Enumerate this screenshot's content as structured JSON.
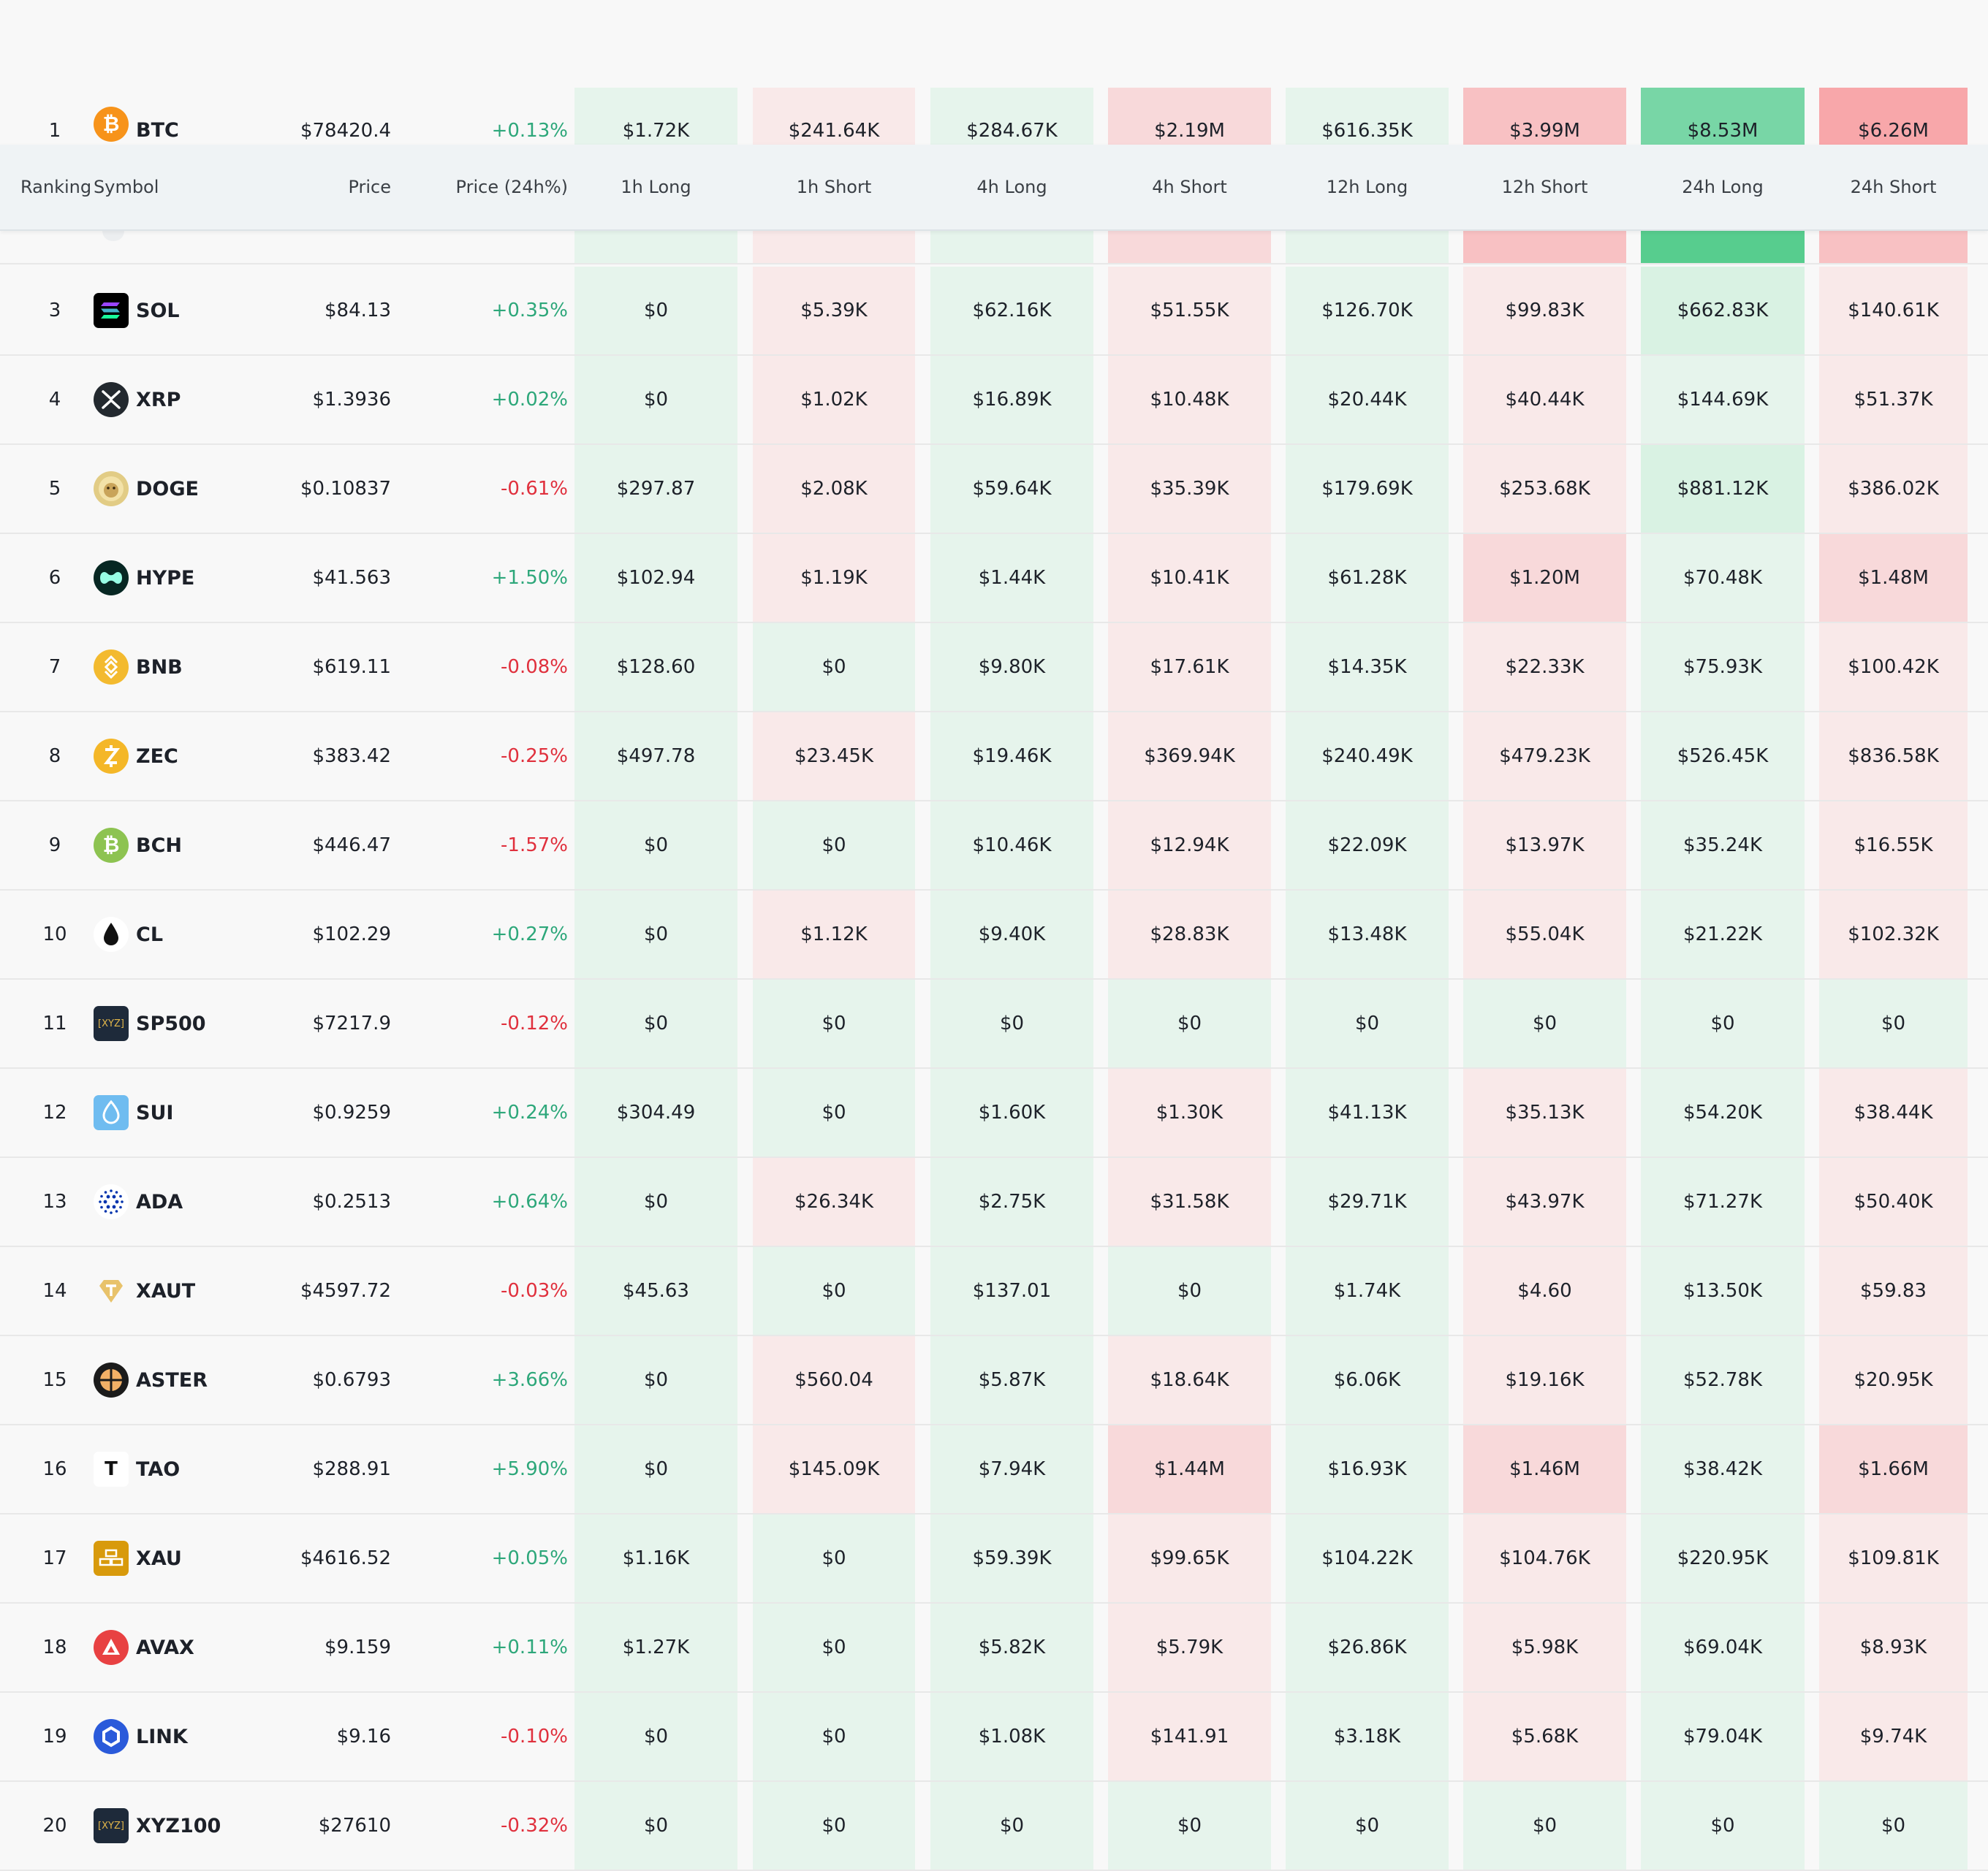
{
  "colors": {
    "long_light": "#e6f4ec",
    "long_mid": "#d9f2e3",
    "long_strong": "#78d6a6",
    "long_stronger": "#57cd8e",
    "short_light": "#f9e9e9",
    "short_mid": "#f8d9da",
    "short_strong": "#f8c1c3",
    "short_stronger": "#f8a7aa",
    "positive_text": "#2da77a",
    "negative_text": "#e0303d",
    "header_bg": "#eff3f5"
  },
  "header": {
    "ranking": "Ranking",
    "symbol": "Symbol",
    "price": "Price",
    "price_24h": "Price (24h%)",
    "h1_long": "1h Long",
    "h1_short": "1h Short",
    "h4_long": "4h Long",
    "h4_short": "4h Short",
    "h12_long": "12h Long",
    "h12_short": "12h Short",
    "h24_long": "24h Long",
    "h24_short": "24h Short"
  },
  "rows": [
    {
      "rank": "1",
      "symbol": "BTC",
      "icon": "bitcoin-icon",
      "price": "$78420.4",
      "change": "+0.13%",
      "dir": "pos",
      "liq": [
        "$1.72K",
        "$241.64K",
        "$284.67K",
        "$2.19M",
        "$616.35K",
        "$3.99M",
        "$8.53M",
        "$6.26M"
      ],
      "bg": [
        "long_light",
        "short_light",
        "long_light",
        "short_mid",
        "long_light",
        "short_strong",
        "long_strong",
        "short_stronger"
      ]
    },
    {
      "rank": "3",
      "symbol": "SOL",
      "icon": "solana-icon",
      "price": "$84.13",
      "change": "+0.35%",
      "dir": "pos",
      "liq": [
        "$0",
        "$5.39K",
        "$62.16K",
        "$51.55K",
        "$126.70K",
        "$99.83K",
        "$662.83K",
        "$140.61K"
      ],
      "bg": [
        "long_light",
        "short_light",
        "long_light",
        "short_light",
        "long_light",
        "short_light",
        "long_mid",
        "short_light"
      ]
    },
    {
      "rank": "4",
      "symbol": "XRP",
      "icon": "xrp-icon",
      "price": "$1.3936",
      "change": "+0.02%",
      "dir": "pos",
      "liq": [
        "$0",
        "$1.02K",
        "$16.89K",
        "$10.48K",
        "$20.44K",
        "$40.44K",
        "$144.69K",
        "$51.37K"
      ],
      "bg": [
        "long_light",
        "short_light",
        "long_light",
        "short_light",
        "long_light",
        "short_light",
        "long_light",
        "short_light"
      ]
    },
    {
      "rank": "5",
      "symbol": "DOGE",
      "icon": "doge-icon",
      "price": "$0.10837",
      "change": "-0.61%",
      "dir": "neg",
      "liq": [
        "$297.87",
        "$2.08K",
        "$59.64K",
        "$35.39K",
        "$179.69K",
        "$253.68K",
        "$881.12K",
        "$386.02K"
      ],
      "bg": [
        "long_light",
        "short_light",
        "long_light",
        "short_light",
        "long_light",
        "short_light",
        "long_mid",
        "short_light"
      ]
    },
    {
      "rank": "6",
      "symbol": "HYPE",
      "icon": "hype-icon",
      "price": "$41.563",
      "change": "+1.50%",
      "dir": "pos",
      "liq": [
        "$102.94",
        "$1.19K",
        "$1.44K",
        "$10.41K",
        "$61.28K",
        "$1.20M",
        "$70.48K",
        "$1.48M"
      ],
      "bg": [
        "long_light",
        "short_light",
        "long_light",
        "short_light",
        "long_light",
        "short_mid",
        "long_light",
        "short_mid"
      ]
    },
    {
      "rank": "7",
      "symbol": "BNB",
      "icon": "bnb-icon",
      "price": "$619.11",
      "change": "-0.08%",
      "dir": "neg",
      "liq": [
        "$128.60",
        "$0",
        "$9.80K",
        "$17.61K",
        "$14.35K",
        "$22.33K",
        "$75.93K",
        "$100.42K"
      ],
      "bg": [
        "long_light",
        "long_light",
        "long_light",
        "short_light",
        "long_light",
        "short_light",
        "long_light",
        "short_light"
      ]
    },
    {
      "rank": "8",
      "symbol": "ZEC",
      "icon": "zcash-icon",
      "price": "$383.42",
      "change": "-0.25%",
      "dir": "neg",
      "liq": [
        "$497.78",
        "$23.45K",
        "$19.46K",
        "$369.94K",
        "$240.49K",
        "$479.23K",
        "$526.45K",
        "$836.58K"
      ],
      "bg": [
        "long_light",
        "short_light",
        "long_light",
        "short_light",
        "long_light",
        "short_light",
        "long_light",
        "short_light"
      ]
    },
    {
      "rank": "9",
      "symbol": "BCH",
      "icon": "bitcoin-cash-icon",
      "price": "$446.47",
      "change": "-1.57%",
      "dir": "neg",
      "liq": [
        "$0",
        "$0",
        "$10.46K",
        "$12.94K",
        "$22.09K",
        "$13.97K",
        "$35.24K",
        "$16.55K"
      ],
      "bg": [
        "long_light",
        "long_light",
        "long_light",
        "short_light",
        "long_light",
        "short_light",
        "long_light",
        "short_light"
      ]
    },
    {
      "rank": "10",
      "symbol": "CL",
      "icon": "oil-drop-icon",
      "price": "$102.29",
      "change": "+0.27%",
      "dir": "pos",
      "liq": [
        "$0",
        "$1.12K",
        "$9.40K",
        "$28.83K",
        "$13.48K",
        "$55.04K",
        "$21.22K",
        "$102.32K"
      ],
      "bg": [
        "long_light",
        "short_light",
        "long_light",
        "short_light",
        "long_light",
        "short_light",
        "long_light",
        "short_light"
      ]
    },
    {
      "rank": "11",
      "symbol": "SP500",
      "icon": "xyz-icon",
      "price": "$7217.9",
      "change": "-0.12%",
      "dir": "neg",
      "liq": [
        "$0",
        "$0",
        "$0",
        "$0",
        "$0",
        "$0",
        "$0",
        "$0"
      ],
      "bg": [
        "long_light",
        "long_light",
        "long_light",
        "long_light",
        "long_light",
        "long_light",
        "long_light",
        "long_light"
      ]
    },
    {
      "rank": "12",
      "symbol": "SUI",
      "icon": "sui-icon",
      "price": "$0.9259",
      "change": "+0.24%",
      "dir": "pos",
      "liq": [
        "$304.49",
        "$0",
        "$1.60K",
        "$1.30K",
        "$41.13K",
        "$35.13K",
        "$54.20K",
        "$38.44K"
      ],
      "bg": [
        "long_light",
        "long_light",
        "long_light",
        "short_light",
        "long_light",
        "short_light",
        "long_light",
        "short_light"
      ]
    },
    {
      "rank": "13",
      "symbol": "ADA",
      "icon": "cardano-icon",
      "price": "$0.2513",
      "change": "+0.64%",
      "dir": "pos",
      "liq": [
        "$0",
        "$26.34K",
        "$2.75K",
        "$31.58K",
        "$29.71K",
        "$43.97K",
        "$71.27K",
        "$50.40K"
      ],
      "bg": [
        "long_light",
        "short_light",
        "long_light",
        "short_light",
        "long_light",
        "short_light",
        "long_light",
        "short_light"
      ]
    },
    {
      "rank": "14",
      "symbol": "XAUT",
      "icon": "tether-gold-icon",
      "price": "$4597.72",
      "change": "-0.03%",
      "dir": "neg",
      "liq": [
        "$45.63",
        "$0",
        "$137.01",
        "$0",
        "$1.74K",
        "$4.60",
        "$13.50K",
        "$59.83"
      ],
      "bg": [
        "long_light",
        "long_light",
        "long_light",
        "long_light",
        "long_light",
        "short_light",
        "long_light",
        "short_light"
      ]
    },
    {
      "rank": "15",
      "symbol": "ASTER",
      "icon": "aster-icon",
      "price": "$0.6793",
      "change": "+3.66%",
      "dir": "pos",
      "liq": [
        "$0",
        "$560.04",
        "$5.87K",
        "$18.64K",
        "$6.06K",
        "$19.16K",
        "$52.78K",
        "$20.95K"
      ],
      "bg": [
        "long_light",
        "short_light",
        "long_light",
        "short_light",
        "long_light",
        "short_light",
        "long_light",
        "short_light"
      ]
    },
    {
      "rank": "16",
      "symbol": "TAO",
      "icon": "tao-icon",
      "price": "$288.91",
      "change": "+5.90%",
      "dir": "pos",
      "liq": [
        "$0",
        "$145.09K",
        "$7.94K",
        "$1.44M",
        "$16.93K",
        "$1.46M",
        "$38.42K",
        "$1.66M"
      ],
      "bg": [
        "long_light",
        "short_light",
        "long_light",
        "short_mid",
        "long_light",
        "short_mid",
        "long_light",
        "short_mid"
      ]
    },
    {
      "rank": "17",
      "symbol": "XAU",
      "icon": "gold-bars-icon",
      "price": "$4616.52",
      "change": "+0.05%",
      "dir": "pos",
      "liq": [
        "$1.16K",
        "$0",
        "$59.39K",
        "$99.65K",
        "$104.22K",
        "$104.76K",
        "$220.95K",
        "$109.81K"
      ],
      "bg": [
        "long_light",
        "long_light",
        "long_light",
        "short_light",
        "long_light",
        "short_light",
        "long_light",
        "short_light"
      ]
    },
    {
      "rank": "18",
      "symbol": "AVAX",
      "icon": "avalanche-icon",
      "price": "$9.159",
      "change": "+0.11%",
      "dir": "pos",
      "liq": [
        "$1.27K",
        "$0",
        "$5.82K",
        "$5.79K",
        "$26.86K",
        "$5.98K",
        "$69.04K",
        "$8.93K"
      ],
      "bg": [
        "long_light",
        "long_light",
        "long_light",
        "short_light",
        "long_light",
        "short_light",
        "long_light",
        "short_light"
      ]
    },
    {
      "rank": "19",
      "symbol": "LINK",
      "icon": "chainlink-icon",
      "price": "$9.16",
      "change": "-0.10%",
      "dir": "neg",
      "liq": [
        "$0",
        "$0",
        "$1.08K",
        "$141.91",
        "$3.18K",
        "$5.68K",
        "$79.04K",
        "$9.74K"
      ],
      "bg": [
        "long_light",
        "long_light",
        "long_light",
        "short_light",
        "long_light",
        "short_light",
        "long_light",
        "short_light"
      ]
    },
    {
      "rank": "20",
      "symbol": "XYZ100",
      "icon": "xyz-icon",
      "price": "$27610",
      "change": "-0.32%",
      "dir": "neg",
      "liq": [
        "$0",
        "$0",
        "$0",
        "$0",
        "$0",
        "$0",
        "$0",
        "$0"
      ],
      "bg": [
        "long_light",
        "long_light",
        "long_light",
        "long_light",
        "long_light",
        "long_light",
        "long_light",
        "long_light"
      ]
    }
  ],
  "icon_text": {
    "xyz": "[XYZ]",
    "tao": "T"
  }
}
